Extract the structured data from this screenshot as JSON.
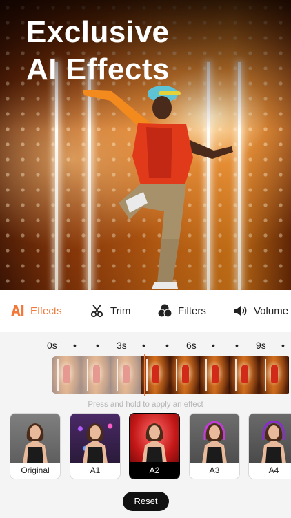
{
  "hero": {
    "title_line1": "Exclusive",
    "title_line2": "AI Effects"
  },
  "tabs": [
    {
      "label": "Effects",
      "icon": "ai-icon",
      "active": true
    },
    {
      "label": "Trim",
      "icon": "scissors-icon",
      "active": false
    },
    {
      "label": "Filters",
      "icon": "filters-icon",
      "active": false
    },
    {
      "label": "Volume",
      "icon": "speaker-icon",
      "active": false
    }
  ],
  "timeline": {
    "ticks": [
      "0s",
      "•",
      "•",
      "3s",
      "•",
      "•",
      "6s",
      "•",
      "•",
      "9s",
      "•"
    ],
    "hint": "Press and hold to apply an effect"
  },
  "effects": [
    {
      "label": "Original",
      "selected": false
    },
    {
      "label": "A1",
      "selected": false
    },
    {
      "label": "A2",
      "selected": true
    },
    {
      "label": "A3",
      "selected": false
    },
    {
      "label": "A4",
      "selected": false
    }
  ],
  "reset_label": "Reset",
  "colors": {
    "accent": "#f2793b",
    "selected": "#000000",
    "hero_warm": "#d77a18"
  }
}
